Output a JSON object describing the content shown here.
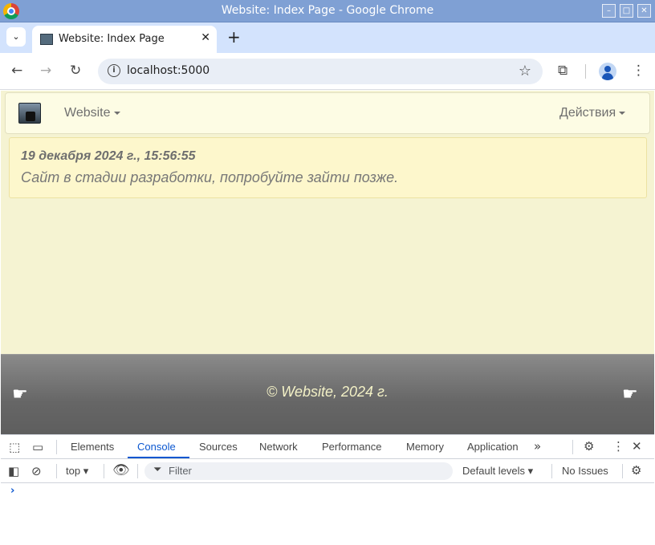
{
  "window": {
    "title": "Website: Index Page - Google Chrome",
    "minimize_glyph": "–",
    "maximize_glyph": "□",
    "close_glyph": "✕"
  },
  "tabs": {
    "list_glyph": "⌄",
    "active_title": "Website: Index Page",
    "close_glyph": "✕",
    "new_tab_glyph": "+"
  },
  "toolbar": {
    "back_glyph": "←",
    "forward_glyph": "→",
    "reload_glyph": "↻",
    "url": "localhost:5000",
    "info_glyph": "i",
    "star_glyph": "☆",
    "extensions_glyph": "⧉",
    "menu_glyph": "⋮"
  },
  "site": {
    "nav_brand": "Website",
    "nav_actions": "Действия",
    "alert_date": "19 декабря 2024 г., 15:56:55",
    "alert_message": "Сайт в стадии разработки, попробуйте зайти позже.",
    "footer_text": "© Website, 2024 г.",
    "hand_left": "☛",
    "hand_right": "☛"
  },
  "devtools": {
    "tabs": [
      "Elements",
      "Console",
      "Sources",
      "Network",
      "Performance",
      "Memory",
      "Application"
    ],
    "active_tab": "Console",
    "more_tabs_glyph": "»",
    "context": "top",
    "filter_placeholder": "Filter",
    "levels": "Default levels",
    "issues": "No Issues",
    "prompt_glyph": "›"
  },
  "icons": {
    "inspect": "inspect-element-icon",
    "device": "device-toolbar-icon",
    "settings": "gear-icon",
    "sidebar": "sidebar-toggle-icon",
    "clear": "clear-console-icon",
    "eye": "live-expression-eye-icon"
  },
  "colors": {
    "titlebar": "#7fa0d4",
    "tabstrip": "#d3e3fd",
    "page_bg": "#f5f3d2",
    "alert_bg": "#fdf7cc",
    "footer": "#6a6a6a",
    "devtools_accent": "#0b57d0"
  }
}
